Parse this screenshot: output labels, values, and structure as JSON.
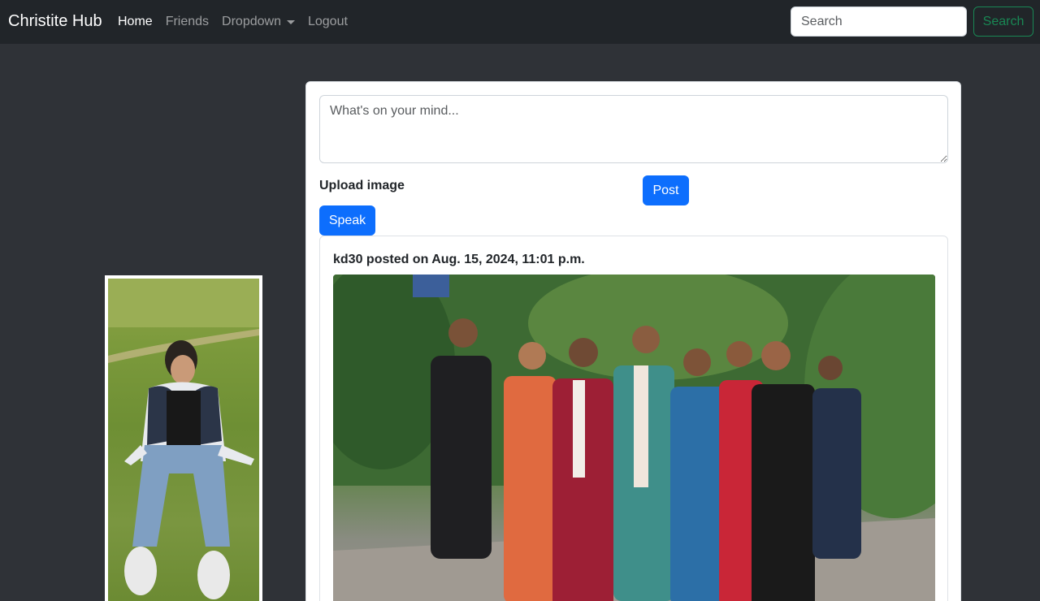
{
  "navbar": {
    "brand": "Christite Hub",
    "links": [
      {
        "label": "Home",
        "active": true
      },
      {
        "label": "Friends",
        "active": false
      },
      {
        "label": "Dropdown",
        "active": false
      },
      {
        "label": "Logout",
        "active": false
      }
    ],
    "search_placeholder": "Search",
    "search_button": "Search"
  },
  "composer": {
    "placeholder": "What's on your mind...",
    "upload_label": "Upload image",
    "post_button": "Post",
    "speak_button": "Speak"
  },
  "post": {
    "header": "kd30 posted on Aug. 15, 2024, 11:01 p.m."
  },
  "colors": {
    "navbar_bg": "#212529",
    "page_bg": "#2f3237",
    "primary": "#0d6efd",
    "success": "#198754"
  }
}
